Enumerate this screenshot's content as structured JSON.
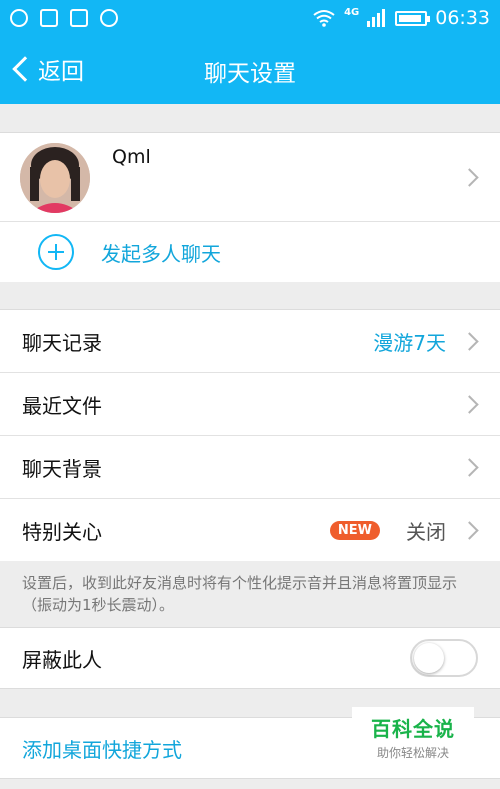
{
  "status_bar": {
    "time": "06:33",
    "network_label": "4G"
  },
  "title_bar": {
    "back_label": "返回",
    "title": "聊天设置"
  },
  "profile": {
    "name": "Qml"
  },
  "group_chat": {
    "label": "发起多人聊天"
  },
  "settings": {
    "chat_history": {
      "label": "聊天记录",
      "value": "漫游7天"
    },
    "recent_files": {
      "label": "最近文件"
    },
    "chat_background": {
      "label": "聊天背景"
    },
    "special_care": {
      "label": "特别关心",
      "badge": "NEW",
      "value": "关闭"
    }
  },
  "hint": "设置后，收到此好友消息时将有个性化提示音并且消息将置顶显示（振动为1秒长震动）。",
  "block": {
    "label": "屏蔽此人",
    "enabled": false
  },
  "shortcut": {
    "label": "添加桌面快捷方式"
  },
  "watermark": {
    "title": "百科全说",
    "subtitle": "助你轻松解决"
  },
  "colors": {
    "accent": "#12b7f5",
    "link": "#12a6db",
    "badge": "#ef5d2c",
    "background": "#ededed"
  }
}
